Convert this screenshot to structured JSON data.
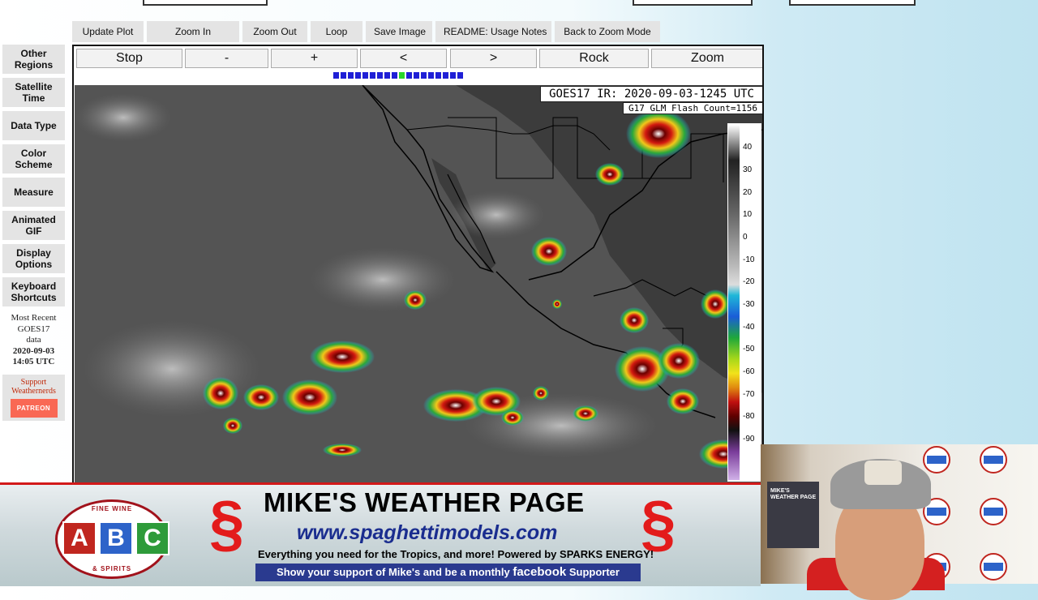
{
  "toolbar": {
    "buttons": [
      "Update Plot",
      "Zoom In",
      "Zoom Out",
      "Loop",
      "Save Image",
      "README: Usage Notes",
      "Back to Zoom Mode"
    ]
  },
  "sidebar": {
    "buttons": [
      "Other Regions",
      "Satellite Time",
      "Data Type",
      "Color Scheme",
      "Measure",
      "Animated GIF",
      "Display Options",
      "Keyboard Shortcuts"
    ],
    "recent_line1": "Most Recent",
    "recent_line2": "GOES17",
    "recent_line3": "data",
    "recent_date": "2020-09-03",
    "recent_time": "14:05 UTC",
    "support_line1": "Support",
    "support_line2": "Weathernerds",
    "patreon_label": "PATREON"
  },
  "controls": {
    "buttons": [
      "Stop",
      "-",
      "+",
      "<",
      ">",
      "Rock",
      "Zoom"
    ],
    "frame_count": 18,
    "current_frame": 10
  },
  "map": {
    "title": "GOES17 IR: 2020-09-03-1245 UTC",
    "subtitle": "G17 GLM Flash Count=1156",
    "scale_ticks": [
      "40",
      "30",
      "20",
      "10",
      "0",
      "-10",
      "-20",
      "-30",
      "-40",
      "-50",
      "-60",
      "-70",
      "-80",
      "-90"
    ]
  },
  "banner": {
    "abc_top": "FINE WINE",
    "abc_letters": [
      "A",
      "B",
      "C"
    ],
    "abc_bottom": "& SPIRITS",
    "title": "MIKE'S WEATHER PAGE",
    "url": "www.spaghettimodels.com",
    "tagline": "Everything you need for the Tropics, and more! Powered by SPARKS ENERGY!",
    "support_pre": "Show your support of Mike's and be a monthly",
    "support_brand": "facebook",
    "support_post": "Supporter"
  },
  "webcam": {
    "poster_text": "MIKE'S WEATHER PAGE"
  },
  "colors": {
    "frame_dot": "#1f1fd6",
    "frame_current": "#29d629",
    "banner_red": "#d21919",
    "patreon": "#f96854"
  }
}
